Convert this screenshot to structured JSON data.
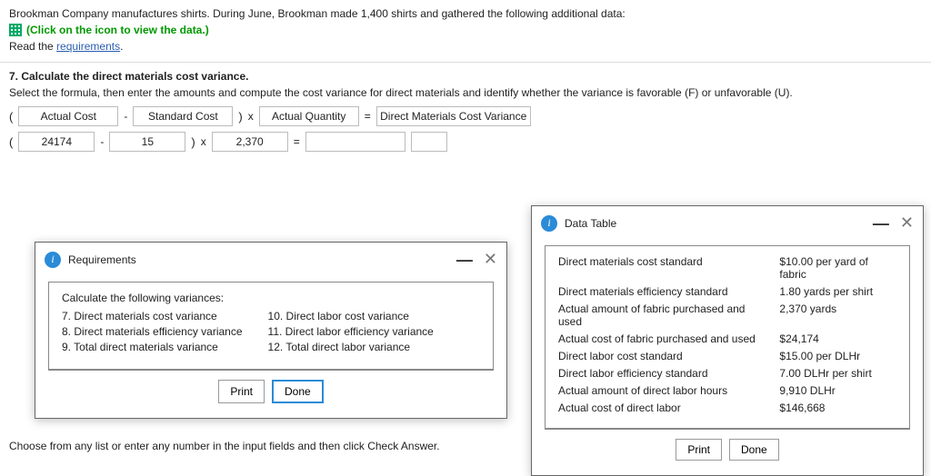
{
  "header": {
    "intro": "Brookman Company manufactures shirts. During June, Brookman made 1,400 shirts and gathered the following additional data:",
    "data_link": "(Click on the icon to view the data.)",
    "read_prefix": "Read the ",
    "read_link": "requirements",
    "read_suffix": "."
  },
  "question": {
    "title": "7. Calculate the direct materials cost variance.",
    "instr": "Select the formula, then enter the amounts and compute the cost variance for direct materials and identify whether the variance is favorable (F) or unfavorable (U).",
    "row1": {
      "a": "Actual Cost",
      "op1": "-",
      "b": "Standard Cost",
      "op2": "x",
      "c": "Actual Quantity",
      "eq": "=",
      "d": "Direct Materials Cost Variance"
    },
    "row2": {
      "a": "24174",
      "op1": "-",
      "b": "15",
      "op2": "x",
      "c": "2,370",
      "eq": "=",
      "d": "",
      "e": ""
    }
  },
  "req_modal": {
    "title": "Requirements",
    "lead": "Calculate the following variances:",
    "left": [
      "7. Direct materials cost variance",
      "8. Direct materials efficiency variance",
      "9. Total direct materials variance"
    ],
    "right": [
      "10. Direct labor cost variance",
      "11. Direct labor efficiency variance",
      "12. Total direct labor variance"
    ],
    "print": "Print",
    "done": "Done"
  },
  "dt_modal": {
    "title": "Data Table",
    "rows": [
      {
        "k": "Direct materials cost standard",
        "v": "$10.00 per yard of fabric"
      },
      {
        "k": "Direct materials efficiency standard",
        "v": "1.80 yards per shirt"
      },
      {
        "k": "Actual amount of fabric purchased and used",
        "v": "2,370 yards"
      },
      {
        "k": "Actual cost of fabric purchased and used",
        "v": "$24,174"
      },
      {
        "k": "Direct labor cost standard",
        "v": "$15.00 per DLHr"
      },
      {
        "k": "Direct labor efficiency standard",
        "v": "7.00 DLHr per shirt"
      },
      {
        "k": "Actual amount of direct labor hours",
        "v": "9,910 DLHr"
      },
      {
        "k": "Actual cost of direct labor",
        "v": "$146,668"
      }
    ],
    "print": "Print",
    "done": "Done"
  },
  "footer": "Choose from any list or enter any number in the input fields and then click Check Answer."
}
